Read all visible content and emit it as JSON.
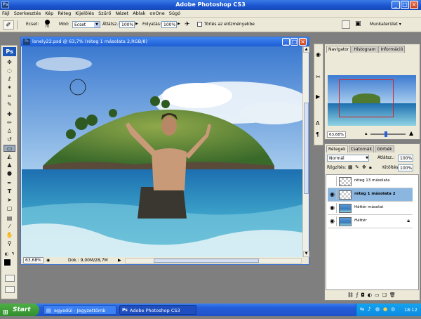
{
  "app": {
    "title": "Adobe Photoshop CS3",
    "logo": "Ps"
  },
  "menu": [
    "Fájl",
    "Szerkesztés",
    "Kép",
    "Réteg",
    "Kijelölés",
    "Szűrő",
    "Nézet",
    "Ablak",
    "onOne",
    "Súgó"
  ],
  "options": {
    "brush_label": "Ecset:",
    "brush_size": "70",
    "mode_label": "Mód:",
    "mode_value": "Ecset",
    "opacity_label": "Átlátsz.:",
    "opacity_value": "100%",
    "flow_label": "Folyatás:",
    "flow_value": "100%",
    "erase_history_label": "Törlés az előzményekbe",
    "workspace_label": "Munkaterület"
  },
  "document": {
    "title": "lonely22.psd @ 63,7% (réteg 1 másolata 2,RGB/8)",
    "zoom": "63,68%",
    "doc_size": "Dok.: 9,00M/28,7M"
  },
  "navigator": {
    "tabs": [
      "Navigator",
      "Histogram",
      "Információ"
    ],
    "zoom": "63,68%"
  },
  "layers_panel": {
    "tabs": [
      "Rétegek",
      "Csatornák",
      "Görbék"
    ],
    "blend_mode": "Normál",
    "opacity_label": "Átlátsz.:",
    "opacity_value": "100%",
    "lock_label": "Rögzítés:",
    "fill_label": "Kitöltés:",
    "fill_value": "100%",
    "layers": [
      {
        "name": "réteg 13 másolata",
        "visible": false,
        "selected": false
      },
      {
        "name": "réteg 1 másolata 2",
        "visible": true,
        "selected": true
      },
      {
        "name": "Háttér másolat",
        "visible": true,
        "selected": false
      },
      {
        "name": "Háttér",
        "visible": true,
        "selected": false
      }
    ]
  },
  "taskbar": {
    "start": "Start",
    "tasks": [
      "egyedül - Jegyzettömb",
      "Adobe Photoshop CS3"
    ],
    "clock": "18:12"
  }
}
